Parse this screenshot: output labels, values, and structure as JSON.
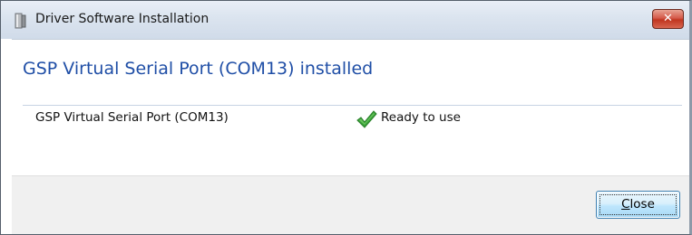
{
  "window": {
    "title": "Driver Software Installation",
    "close_glyph": "✕",
    "app_icon": "driver-install-icon"
  },
  "main": {
    "heading": "GSP Virtual Serial Port (COM13) installed",
    "devices": [
      {
        "name": "GSP Virtual Serial Port (COM13)",
        "status": "Ready to use",
        "status_icon": "check-icon",
        "status_color": "#3aa33a"
      }
    ]
  },
  "footer": {
    "close_label_prefix": "",
    "close_label_mnemonic": "C",
    "close_label_rest": "lose"
  },
  "colors": {
    "heading": "#1f4ea6",
    "footer_bg": "#f0f0f0",
    "close_x_red": "#c0351f"
  }
}
